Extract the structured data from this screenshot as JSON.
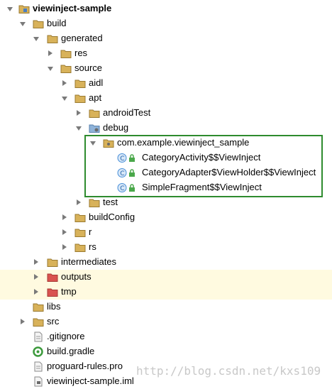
{
  "tree": {
    "root_label": "viewinject-sample",
    "items": {
      "build": "build",
      "generated": "generated",
      "res": "res",
      "source": "source",
      "aidl": "aidl",
      "apt": "apt",
      "androidTest": "androidTest",
      "debug": "debug",
      "package": "com.example.viewinject_sample",
      "class1": "CategoryActivity$$ViewInject",
      "class2": "CategoryAdapter$ViewHolder$$ViewInject",
      "class3": "SimpleFragment$$ViewInject",
      "test": "test",
      "buildConfig": "buildConfig",
      "r": "r",
      "rs": "rs",
      "intermediates": "intermediates",
      "outputs": "outputs",
      "tmp": "tmp",
      "libs": "libs",
      "src": "src",
      "gitignore": ".gitignore",
      "build_gradle": "build.gradle",
      "proguard": "proguard-rules.pro",
      "iml": "viewinject-sample.iml"
    }
  },
  "watermark": "http://blog.csdn.net/kxs109",
  "colors": {
    "folder": "#d8b25a",
    "excluded_folder": "#d9534f",
    "class_icon": "#4a90d9",
    "highlight_box": "#2e8b2e",
    "highlight_row": "#fffae0"
  }
}
